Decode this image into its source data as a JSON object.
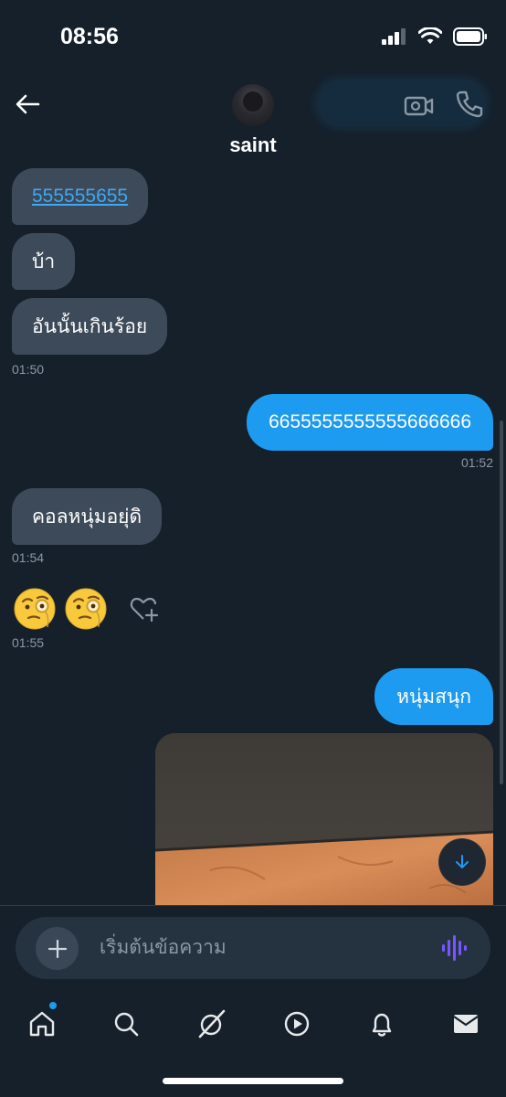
{
  "status": {
    "time": "08:56"
  },
  "header": {
    "contact_name": "saint",
    "icons": {
      "back": "arrow-left-icon",
      "video": "video-camera-icon",
      "call": "phone-icon"
    }
  },
  "messages": [
    {
      "side": "in",
      "text": "555555655",
      "is_link": true
    },
    {
      "side": "in",
      "text": "บ้า"
    },
    {
      "side": "in",
      "text": "อันนั้นเกินร้อย",
      "time": "01:50"
    },
    {
      "side": "out",
      "text": "6655555555555666666",
      "time": "01:52"
    },
    {
      "side": "in",
      "text": "คอลหนุ่มอยุ่ดิ",
      "time": "01:54"
    },
    {
      "side": "in",
      "emoji": "face-with-monocle x2",
      "time": "01:55"
    },
    {
      "side": "out",
      "text": "หนุ่มสนุก"
    },
    {
      "side": "out",
      "type": "image",
      "description": "photo-attachment"
    }
  ],
  "composer": {
    "placeholder": "เริ่มต้นข้อความ"
  },
  "tabbar": {
    "items": [
      "home-icon",
      "search-icon",
      "grok-icon",
      "video-play-icon",
      "bell-icon",
      "mail-icon"
    ],
    "active": "home-icon"
  },
  "colors": {
    "background": "#15202b",
    "bubble_in": "#3d4a59",
    "bubble_out": "#1d9bf0",
    "accent": "#1d9bf0"
  }
}
